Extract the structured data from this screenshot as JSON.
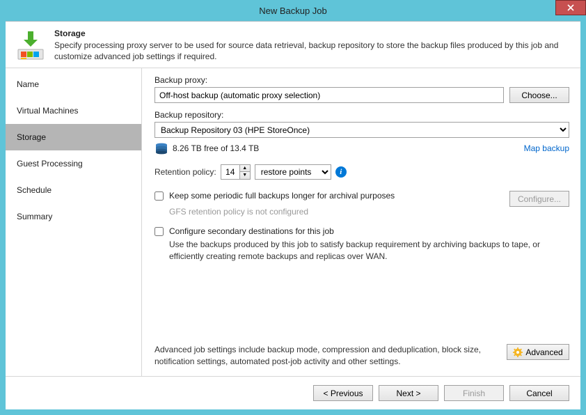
{
  "window": {
    "title": "New Backup Job"
  },
  "header": {
    "title": "Storage",
    "description": "Specify processing proxy server to be used for source data retrieval, backup repository to store the backup files produced by this job and customize advanced job settings if required."
  },
  "sidebar": {
    "items": [
      {
        "label": "Name"
      },
      {
        "label": "Virtual Machines"
      },
      {
        "label": "Storage"
      },
      {
        "label": "Guest Processing"
      },
      {
        "label": "Schedule"
      },
      {
        "label": "Summary"
      }
    ],
    "selected_index": 2
  },
  "main": {
    "proxy_label": "Backup proxy:",
    "proxy_value": "Off-host backup (automatic proxy selection)",
    "choose_label": "Choose...",
    "repo_label": "Backup repository:",
    "repo_value": "Backup Repository 03 (HPE StoreOnce)",
    "storage_info": "8.26 TB free of 13.4 TB",
    "map_backup_label": "Map backup",
    "retention_label": "Retention policy:",
    "retention_value": "14",
    "retention_unit": "restore points",
    "keep_full_label": "Keep some periodic full backups longer for archival purposes",
    "configure_label": "Configure...",
    "gfs_hint": "GFS retention policy is not configured",
    "secondary_label": "Configure secondary destinations for this job",
    "secondary_desc": "Use the backups produced by this job to satisfy backup requirement by archiving backups to tape, or efficiently creating remote backups and replicas over WAN.",
    "advanced_desc": "Advanced job settings include backup mode, compression and deduplication, block size, notification settings, automated post-job activity and other settings.",
    "advanced_label": "Advanced"
  },
  "footer": {
    "previous": "< Previous",
    "next": "Next >",
    "finish": "Finish",
    "cancel": "Cancel"
  }
}
